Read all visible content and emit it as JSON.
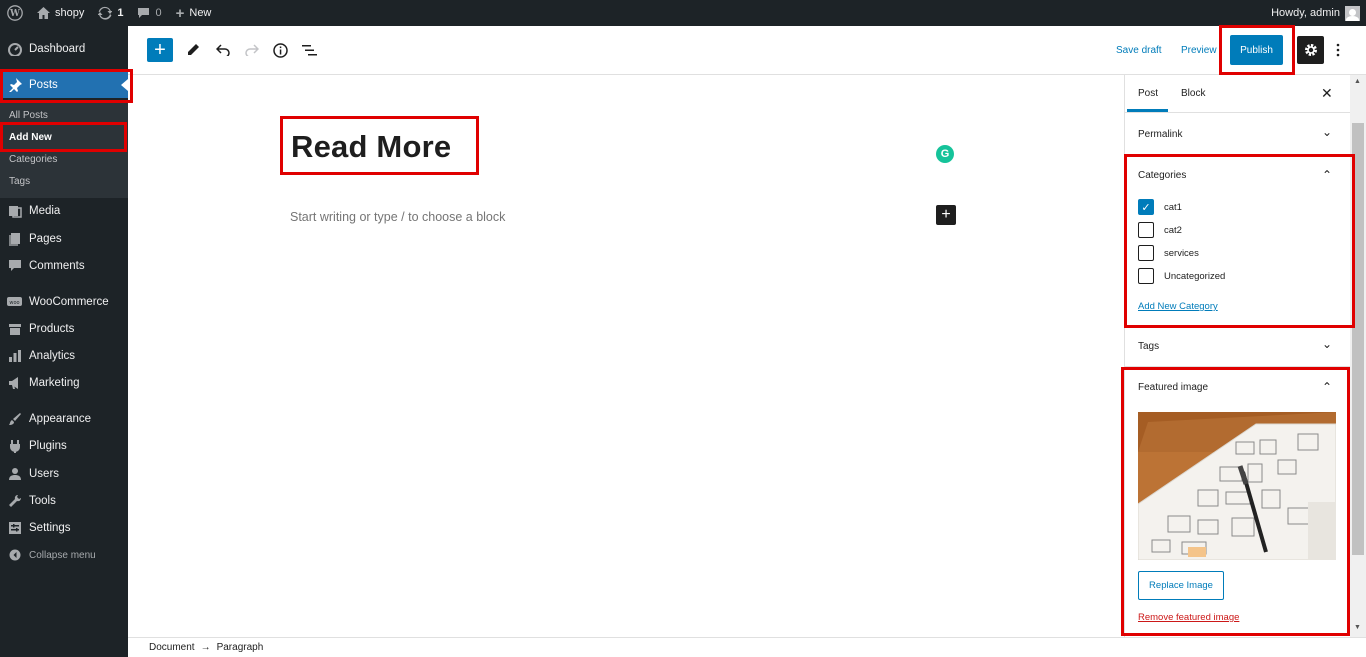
{
  "adminbar": {
    "site_name": "shopy",
    "updates_count": "1",
    "comments_count": "0",
    "new_label": "New",
    "howdy": "Howdy, admin"
  },
  "sidebar": {
    "items": [
      {
        "label": "Dashboard",
        "icon": "dashboard-icon"
      },
      {
        "label": "Posts",
        "icon": "pin-icon"
      },
      {
        "label": "Media",
        "icon": "media-icon"
      },
      {
        "label": "Pages",
        "icon": "pages-icon"
      },
      {
        "label": "Comments",
        "icon": "comments-icon"
      },
      {
        "label": "WooCommerce",
        "icon": "woocommerce-icon"
      },
      {
        "label": "Products",
        "icon": "products-icon"
      },
      {
        "label": "Analytics",
        "icon": "analytics-icon"
      },
      {
        "label": "Marketing",
        "icon": "marketing-icon"
      },
      {
        "label": "Appearance",
        "icon": "appearance-icon"
      },
      {
        "label": "Plugins",
        "icon": "plugins-icon"
      },
      {
        "label": "Users",
        "icon": "users-icon"
      },
      {
        "label": "Tools",
        "icon": "tools-icon"
      },
      {
        "label": "Settings",
        "icon": "settings-icon"
      }
    ],
    "submenu": [
      "All Posts",
      "Add New",
      "Categories",
      "Tags"
    ],
    "collapse_label": "Collapse menu"
  },
  "toolbar": {
    "save_draft": "Save draft",
    "preview": "Preview",
    "publish": "Publish"
  },
  "editor": {
    "title": "Read More",
    "placeholder": "Start writing or type / to choose a block"
  },
  "settings_panel": {
    "tabs": [
      "Post",
      "Block"
    ],
    "permalink": "Permalink",
    "categories_title": "Categories",
    "categories": [
      {
        "name": "cat1",
        "checked": true
      },
      {
        "name": "cat2",
        "checked": false
      },
      {
        "name": "services",
        "checked": false
      },
      {
        "name": "Uncategorized",
        "checked": false
      }
    ],
    "add_new_category": "Add New Category",
    "tags": "Tags",
    "featured_image_title": "Featured image",
    "replace_image": "Replace Image",
    "remove_featured_image": "Remove featured image"
  },
  "footer": {
    "breadcrumb": [
      "Document",
      "Paragraph"
    ],
    "separator": "→"
  },
  "colors": {
    "accent": "#007cba",
    "admin_dark": "#1d2327",
    "menu_active": "#2271b1",
    "highlight": "#e00000"
  }
}
